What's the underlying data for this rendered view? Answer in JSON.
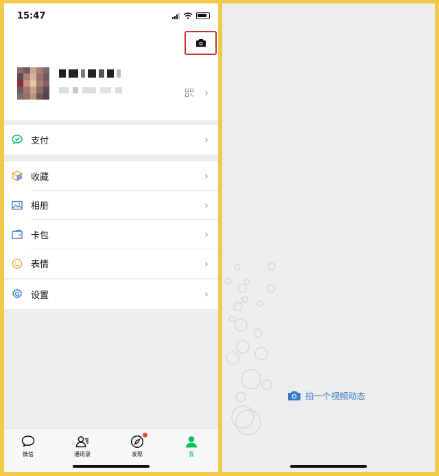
{
  "left": {
    "status": {
      "time": "15:47"
    },
    "menu": {
      "pay": {
        "label": "支付"
      },
      "group2": [
        {
          "key": "favorites",
          "label": "收藏",
          "icon": "cube-icon"
        },
        {
          "key": "album",
          "label": "相册",
          "icon": "image-icon"
        },
        {
          "key": "cards",
          "label": "卡包",
          "icon": "wallet-icon"
        },
        {
          "key": "stickers",
          "label": "表情",
          "icon": "smile-icon"
        }
      ],
      "settings": {
        "label": "设置"
      }
    },
    "tabs": [
      {
        "label": "微信",
        "icon": "chat-bubble-icon",
        "active": false
      },
      {
        "label": "通讯录",
        "icon": "contacts-icon",
        "active": false
      },
      {
        "label": "发现",
        "icon": "compass-icon",
        "active": false,
        "badge": true
      },
      {
        "label": "我",
        "icon": "person-icon",
        "active": true
      }
    ],
    "colors": {
      "accent_green": "#07C160",
      "highlight_red": "#C0392B"
    }
  },
  "right": {
    "cta_label": "拍一个视频动态",
    "colors": {
      "link_blue": "#3A7BC8"
    }
  }
}
